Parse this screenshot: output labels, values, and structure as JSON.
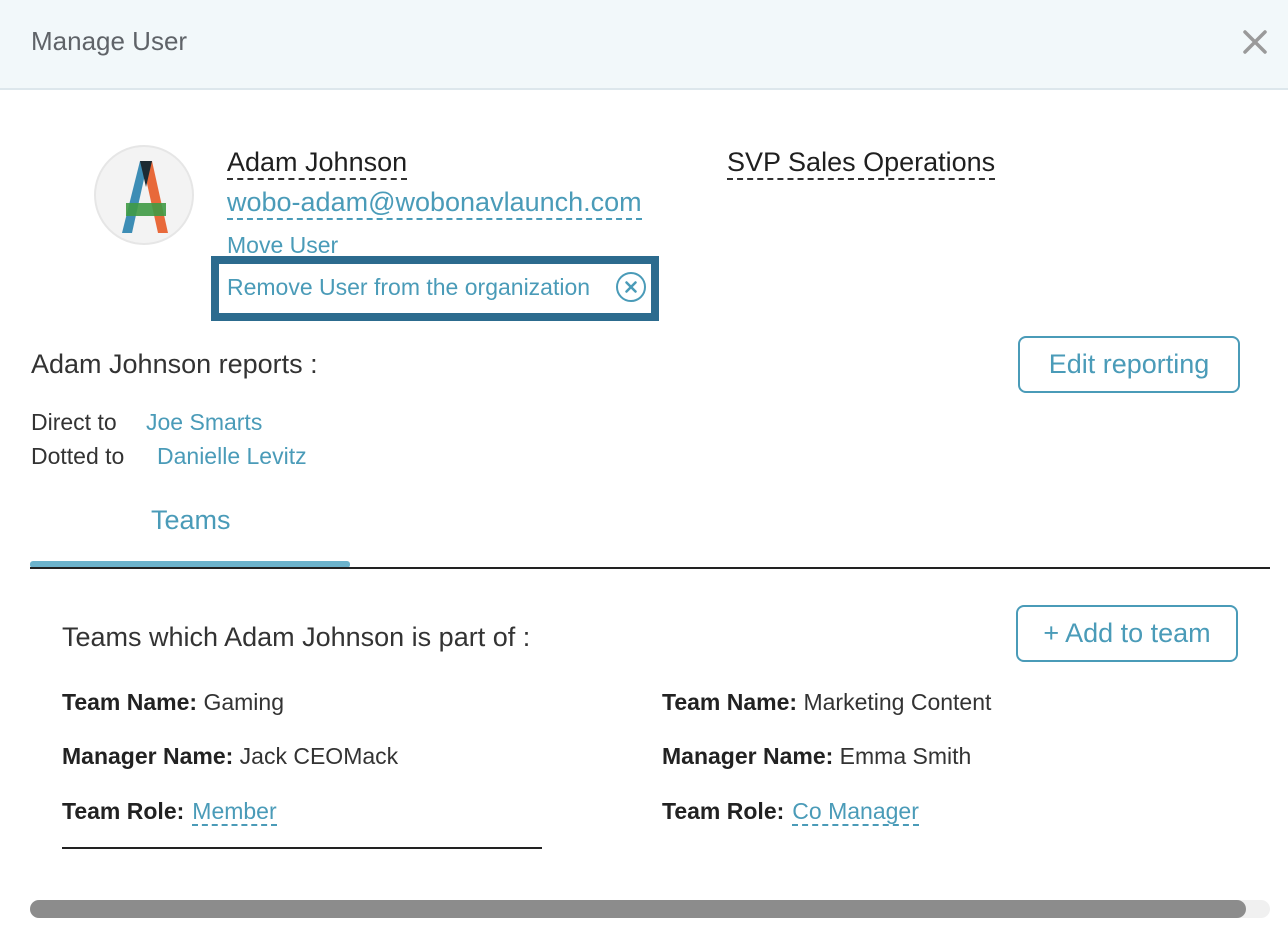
{
  "header": {
    "title": "Manage User"
  },
  "user": {
    "name": "Adam Johnson",
    "email": "wobo-adam@wobonavlaunch.com",
    "job_title": "SVP Sales Operations",
    "move_label": "Move User",
    "remove_label": "Remove User from the organization"
  },
  "reporting": {
    "title": "Adam Johnson reports :",
    "edit_label": "Edit reporting",
    "direct_label": "Direct to",
    "direct_value": "Joe Smarts",
    "dotted_label": "Dotted to",
    "dotted_value": "Danielle Levitz"
  },
  "tabs": [
    {
      "label": "Teams",
      "active": true
    }
  ],
  "teams": {
    "title": "Teams which Adam Johnson is part of :",
    "add_label": "+ Add to team",
    "name_label": "Team Name:",
    "manager_label": "Manager Name:",
    "role_label": "Team Role:",
    "items": [
      {
        "name": "Gaming",
        "manager": "Jack CEOMack",
        "role": "Member"
      },
      {
        "name": "Marketing Content",
        "manager": "Emma Smith",
        "role": "Co Manager"
      }
    ]
  },
  "colors": {
    "accent": "#4a9bb8",
    "highlight_border": "#2c6b8e",
    "header_bg": "#f2f8fa"
  },
  "icons": {
    "close": "close-icon",
    "remove": "circle-x-icon",
    "avatar": "letter-a-logo"
  }
}
